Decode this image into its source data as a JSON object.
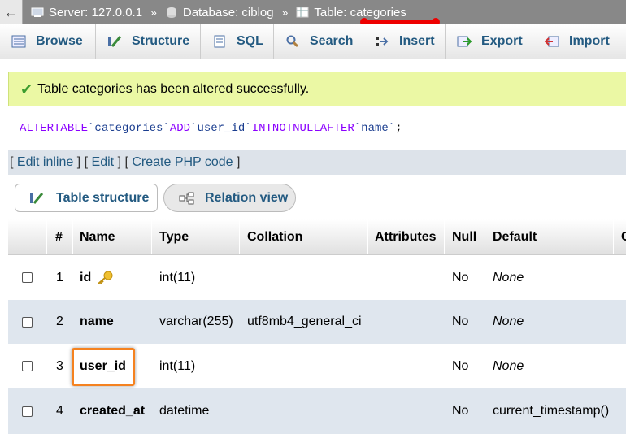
{
  "breadcrumb": {
    "back": "←",
    "server": "Server: 127.0.0.1",
    "database": "Database: ciblog",
    "table": "Table: categories",
    "sep": "»"
  },
  "tabs": [
    {
      "label": "Browse",
      "icon": "browse-icon"
    },
    {
      "label": "Structure",
      "icon": "structure-icon"
    },
    {
      "label": "SQL",
      "icon": "sql-icon"
    },
    {
      "label": "Search",
      "icon": "search-icon"
    },
    {
      "label": "Insert",
      "icon": "insert-icon"
    },
    {
      "label": "Export",
      "icon": "export-icon"
    },
    {
      "label": "Import",
      "icon": "import-icon"
    }
  ],
  "success_message": "Table categories has been altered successfully.",
  "sql": {
    "alter": "ALTER",
    "table_kw": "TABLE",
    "table_name": "`categories`",
    "add": "ADD",
    "column": "`user_id`",
    "int": "INT",
    "not": "NOT",
    "null": "NULL",
    "after": "AFTER",
    "after_col": "`name`",
    "end": ";"
  },
  "links": {
    "open1": "[",
    "edit_inline": "Edit inline",
    "mid1": "] [",
    "edit": "Edit",
    "mid2": "] [",
    "create_php": "Create PHP code",
    "close": "]"
  },
  "subtabs": {
    "table_structure": "Table structure",
    "relation_view": "Relation view"
  },
  "table": {
    "headers": {
      "num": "#",
      "name": "Name",
      "type": "Type",
      "collation": "Collation",
      "attributes": "Attributes",
      "null": "Null",
      "default": "Default",
      "extra": "C"
    },
    "rows": [
      {
        "num": "1",
        "name": "id",
        "type": "int(11)",
        "collation": "",
        "null": "No",
        "default": "None"
      },
      {
        "num": "2",
        "name": "name",
        "type": "varchar(255)",
        "collation": "utf8mb4_general_ci",
        "null": "No",
        "default": "None"
      },
      {
        "num": "3",
        "name": "user_id",
        "type": "int(11)",
        "collation": "",
        "null": "No",
        "default": "None"
      },
      {
        "num": "4",
        "name": "created_at",
        "type": "datetime",
        "collation": "",
        "null": "No",
        "default": "current_timestamp()"
      }
    ]
  },
  "colors": {
    "highlight": "#f5821f",
    "annotation": "#e00000",
    "success_bg": "#ebf8a4"
  }
}
